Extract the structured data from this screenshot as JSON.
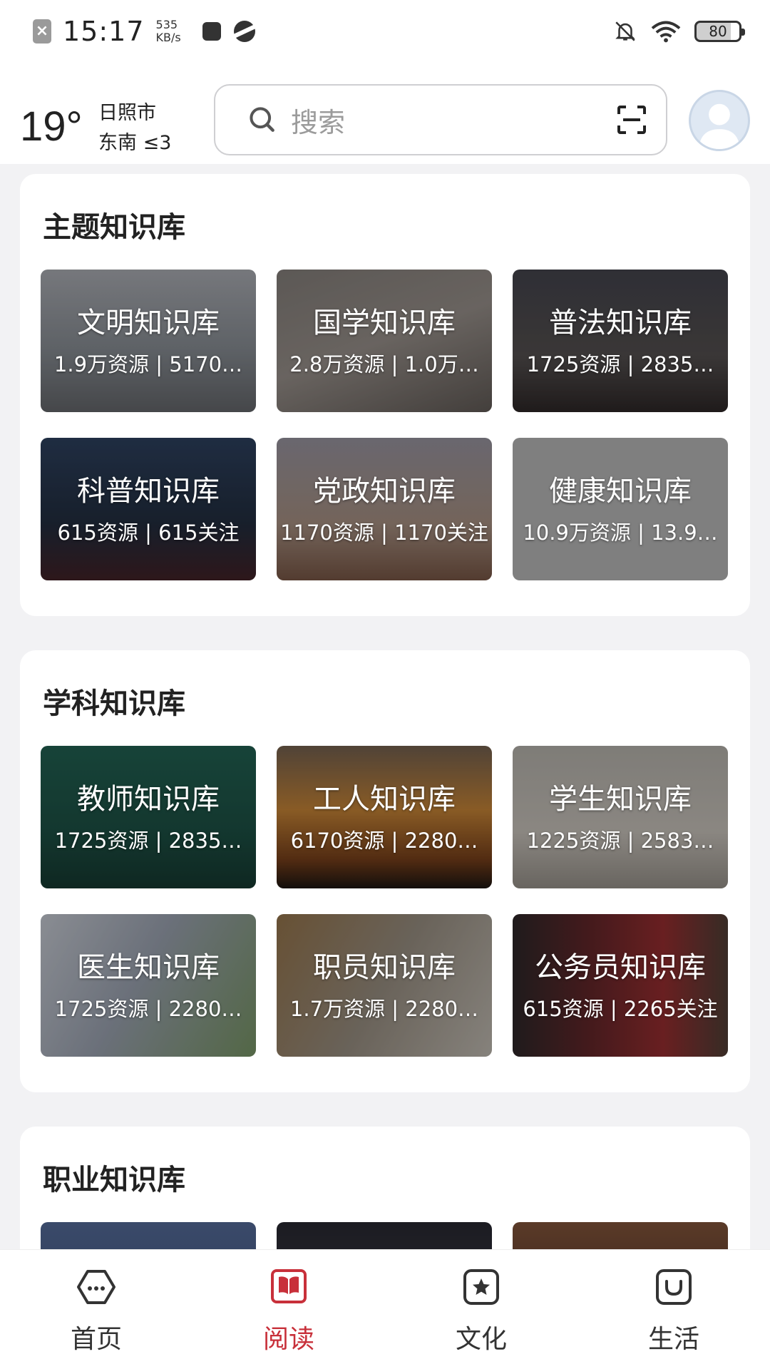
{
  "status_bar": {
    "time": "15:17",
    "speed_value": "535",
    "speed_unit": "KB/s",
    "battery": "80"
  },
  "header": {
    "temperature": "19°",
    "city": "日照市",
    "wind": "东南  ≤3",
    "search_placeholder": "搜索"
  },
  "sections": [
    {
      "title": "主题知识库",
      "tiles": [
        {
          "name": "文明知识库",
          "stats": "1.9万资源 | 5170…"
        },
        {
          "name": "国学知识库",
          "stats": "2.8万资源 | 1.0万…"
        },
        {
          "name": "普法知识库",
          "stats": "1725资源 | 2835…"
        },
        {
          "name": "科普知识库",
          "stats": "615资源 | 615关注"
        },
        {
          "name": "党政知识库",
          "stats": "1170资源 | 1170关注"
        },
        {
          "name": "健康知识库",
          "stats": "10.9万资源 | 13.9…"
        }
      ]
    },
    {
      "title": "学科知识库",
      "tiles": [
        {
          "name": "教师知识库",
          "stats": "1725资源 | 2835…"
        },
        {
          "name": "工人知识库",
          "stats": "6170资源 | 2280…"
        },
        {
          "name": "学生知识库",
          "stats": "1225资源 | 2583…"
        },
        {
          "name": "医生知识库",
          "stats": "1725资源 | 2280…"
        },
        {
          "name": "职员知识库",
          "stats": "1.7万资源 | 2280…"
        },
        {
          "name": "公务员知识库",
          "stats": "615资源 | 2265关注"
        }
      ]
    },
    {
      "title": "职业知识库"
    }
  ],
  "bottom_nav": [
    {
      "label": "首页",
      "icon": "home-hex-icon"
    },
    {
      "label": "阅读",
      "icon": "book-icon",
      "active": true
    },
    {
      "label": "文化",
      "icon": "star-square-icon"
    },
    {
      "label": "生活",
      "icon": "smile-square-icon"
    }
  ],
  "colors": {
    "accent": "#c8303a",
    "background": "#f2f2f4"
  }
}
